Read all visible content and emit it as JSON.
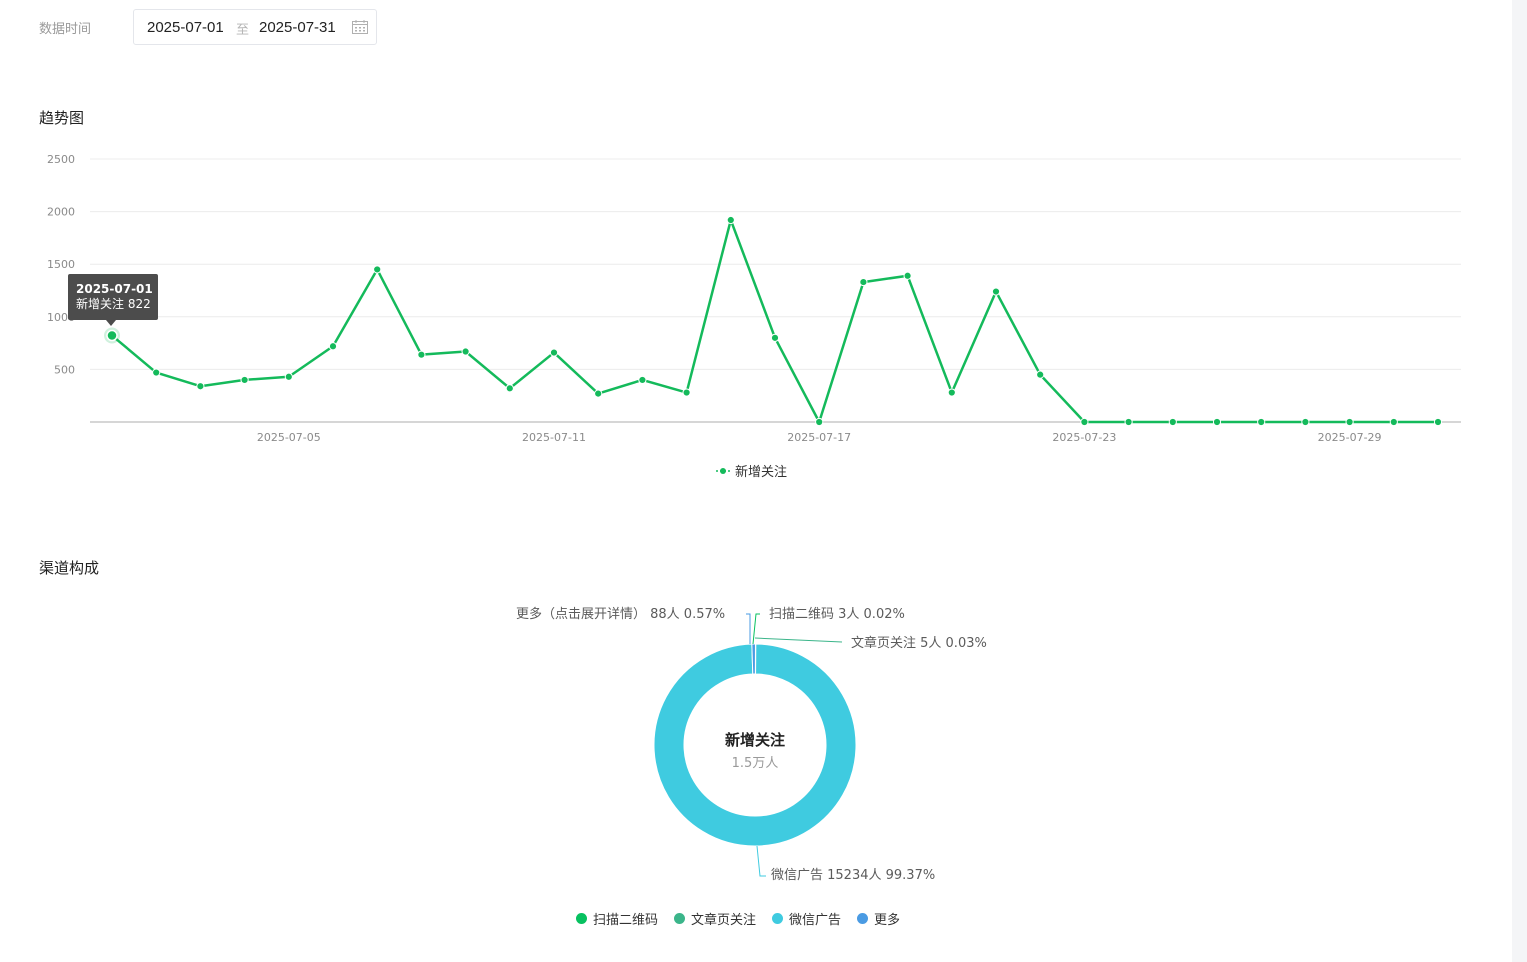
{
  "filter": {
    "label": "数据时间",
    "start_date": "2025-07-01",
    "separator": "至",
    "end_date": "2025-07-31",
    "calendar_icon": "calendar-icon"
  },
  "trend": {
    "title": "趋势图",
    "legend": "新增关注",
    "tooltip": {
      "date": "2025-07-01",
      "text": "新增关注 822"
    }
  },
  "channel": {
    "title": "渠道构成",
    "center_title": "新增关注",
    "center_sub": "1.5万人",
    "labels": {
      "more": "更多（点击展开详情） 88人 0.57%",
      "qrcode": "扫描二维码 3人 0.02%",
      "article": "文章页关注 5人 0.03%",
      "wechat_ad": "微信广告 15234人 99.37%"
    },
    "legend": [
      {
        "label": "扫描二维码",
        "color": "#07c160"
      },
      {
        "label": "文章页关注",
        "color": "#3bb58a"
      },
      {
        "label": "微信广告",
        "color": "#3fcbe0"
      },
      {
        "label": "更多",
        "color": "#4a9be3"
      }
    ]
  },
  "chart_data": [
    {
      "type": "line",
      "title": "",
      "xlabel": "",
      "ylabel": "",
      "ylim": [
        0,
        2500
      ],
      "y_ticks": [
        "2500",
        "2000",
        "1500",
        "1000",
        "500"
      ],
      "x_tick_labels": [
        "2025-07-05",
        "2025-07-11",
        "2025-07-17",
        "2025-07-23",
        "2025-07-29"
      ],
      "x": [
        "2025-07-01",
        "2025-07-02",
        "2025-07-03",
        "2025-07-04",
        "2025-07-05",
        "2025-07-06",
        "2025-07-07",
        "2025-07-08",
        "2025-07-09",
        "2025-07-10",
        "2025-07-11",
        "2025-07-12",
        "2025-07-13",
        "2025-07-14",
        "2025-07-15",
        "2025-07-16",
        "2025-07-17",
        "2025-07-18",
        "2025-07-19",
        "2025-07-20",
        "2025-07-21",
        "2025-07-22",
        "2025-07-23",
        "2025-07-24",
        "2025-07-25",
        "2025-07-26",
        "2025-07-27",
        "2025-07-28",
        "2025-07-29",
        "2025-07-30",
        "2025-07-31"
      ],
      "series": [
        {
          "name": "新增关注",
          "color": "#14ba5b",
          "values": [
            822,
            470,
            340,
            400,
            430,
            720,
            1450,
            640,
            670,
            320,
            660,
            270,
            400,
            280,
            1920,
            800,
            0,
            1330,
            1390,
            280,
            1240,
            450,
            0,
            0,
            0,
            0,
            0,
            0,
            0,
            0,
            0
          ]
        }
      ],
      "grid": true,
      "legend_position": "bottom"
    },
    {
      "type": "pie",
      "title": "新增关注",
      "slices": [
        {
          "label": "扫描二维码",
          "value": 3,
          "percent": 0.02,
          "color": "#07c160"
        },
        {
          "label": "文章页关注",
          "value": 5,
          "percent": 0.03,
          "color": "#3bb58a"
        },
        {
          "label": "微信广告",
          "value": 15234,
          "percent": 99.37,
          "color": "#3fcbe0"
        },
        {
          "label": "更多",
          "value": 88,
          "percent": 0.57,
          "color": "#4a9be3"
        }
      ],
      "legend_position": "bottom"
    }
  ]
}
